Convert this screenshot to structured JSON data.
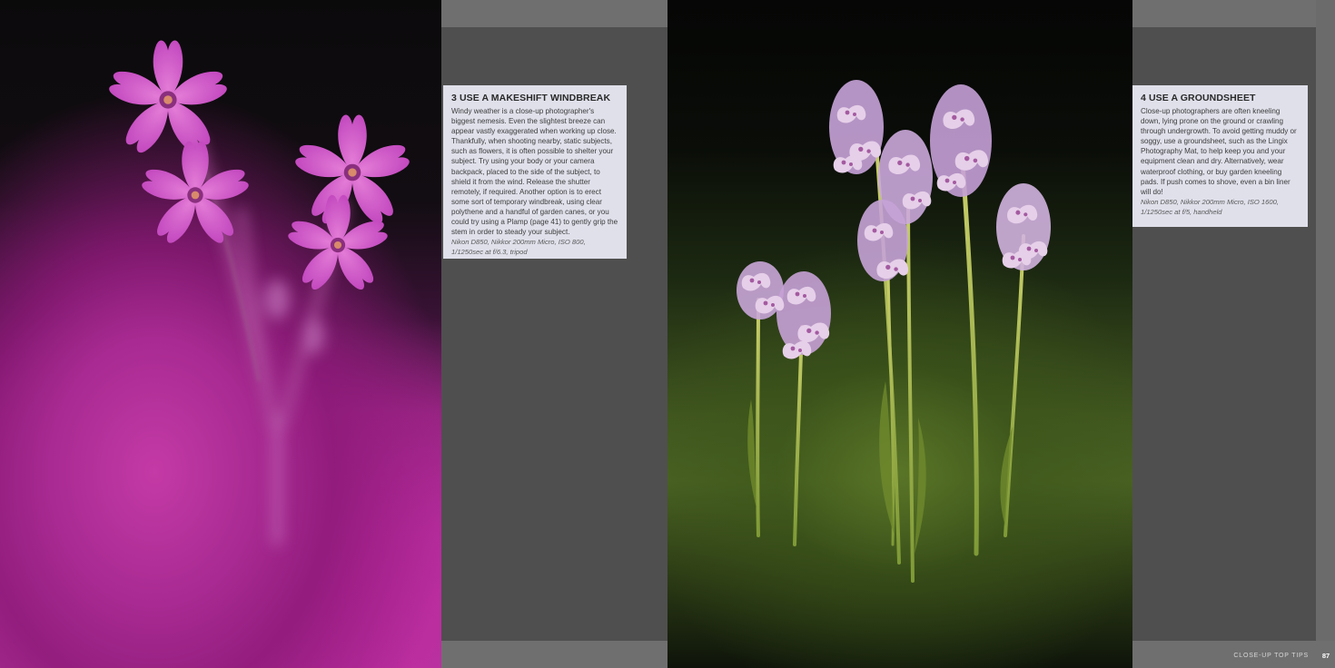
{
  "tips": [
    {
      "heading": "3 USE A MAKESHIFT WINDBREAK",
      "body": "Windy weather is a close-up photographer's biggest nemesis. Even the slightest breeze can appear vastly exaggerated when working up close. Thankfully, when shooting nearby, static subjects, such as flowers, it is often possible to shelter your subject. Try using your body or your camera backpack, placed to the side of the subject, to shield it from the wind. Release the shutter remotely, if required. Another option is to erect some sort of temporary windbreak, using clear polythene and a handful of garden canes, or you could try using a Plamp (page 41) to gently grip the stem in order to steady your subject.",
      "caption": "Nikon D850, Nikkor 200mm Micro, ISO 800, 1/1250sec at f/6.3, tripod"
    },
    {
      "heading": "4 USE A GROUNDSHEET",
      "body": "Close-up photographers are often kneeling down, lying prone on the ground or crawling through undergrowth. To avoid getting muddy or soggy, use a groundsheet, such as the Lingix Photography Mat, to help keep you and your equipment clean and dry. Alternatively, wear waterproof clothing, or buy garden kneeling pads. If push comes to shove, even a bin liner will do!",
      "caption": "Nikon D850, Nikkor 200mm Micro, ISO 1600, 1/1250sec at f/5, handheld"
    }
  ],
  "footer": {
    "section_label": "CLOSE-UP TOP TIPS",
    "page_number": "87"
  },
  "photos": [
    {
      "subject": "pink-campion-flowers-icon"
    },
    {
      "subject": "spotted-orchids-icon"
    }
  ],
  "colors": {
    "page_gray": "#6f6f6f",
    "panel_gray": "#4f4f4f",
    "tip_box": "#dfe0ea",
    "flower_pink": "#c02fa0",
    "orchid_lilac": "#c9a6d8",
    "stem_green": "#9aab4a"
  }
}
